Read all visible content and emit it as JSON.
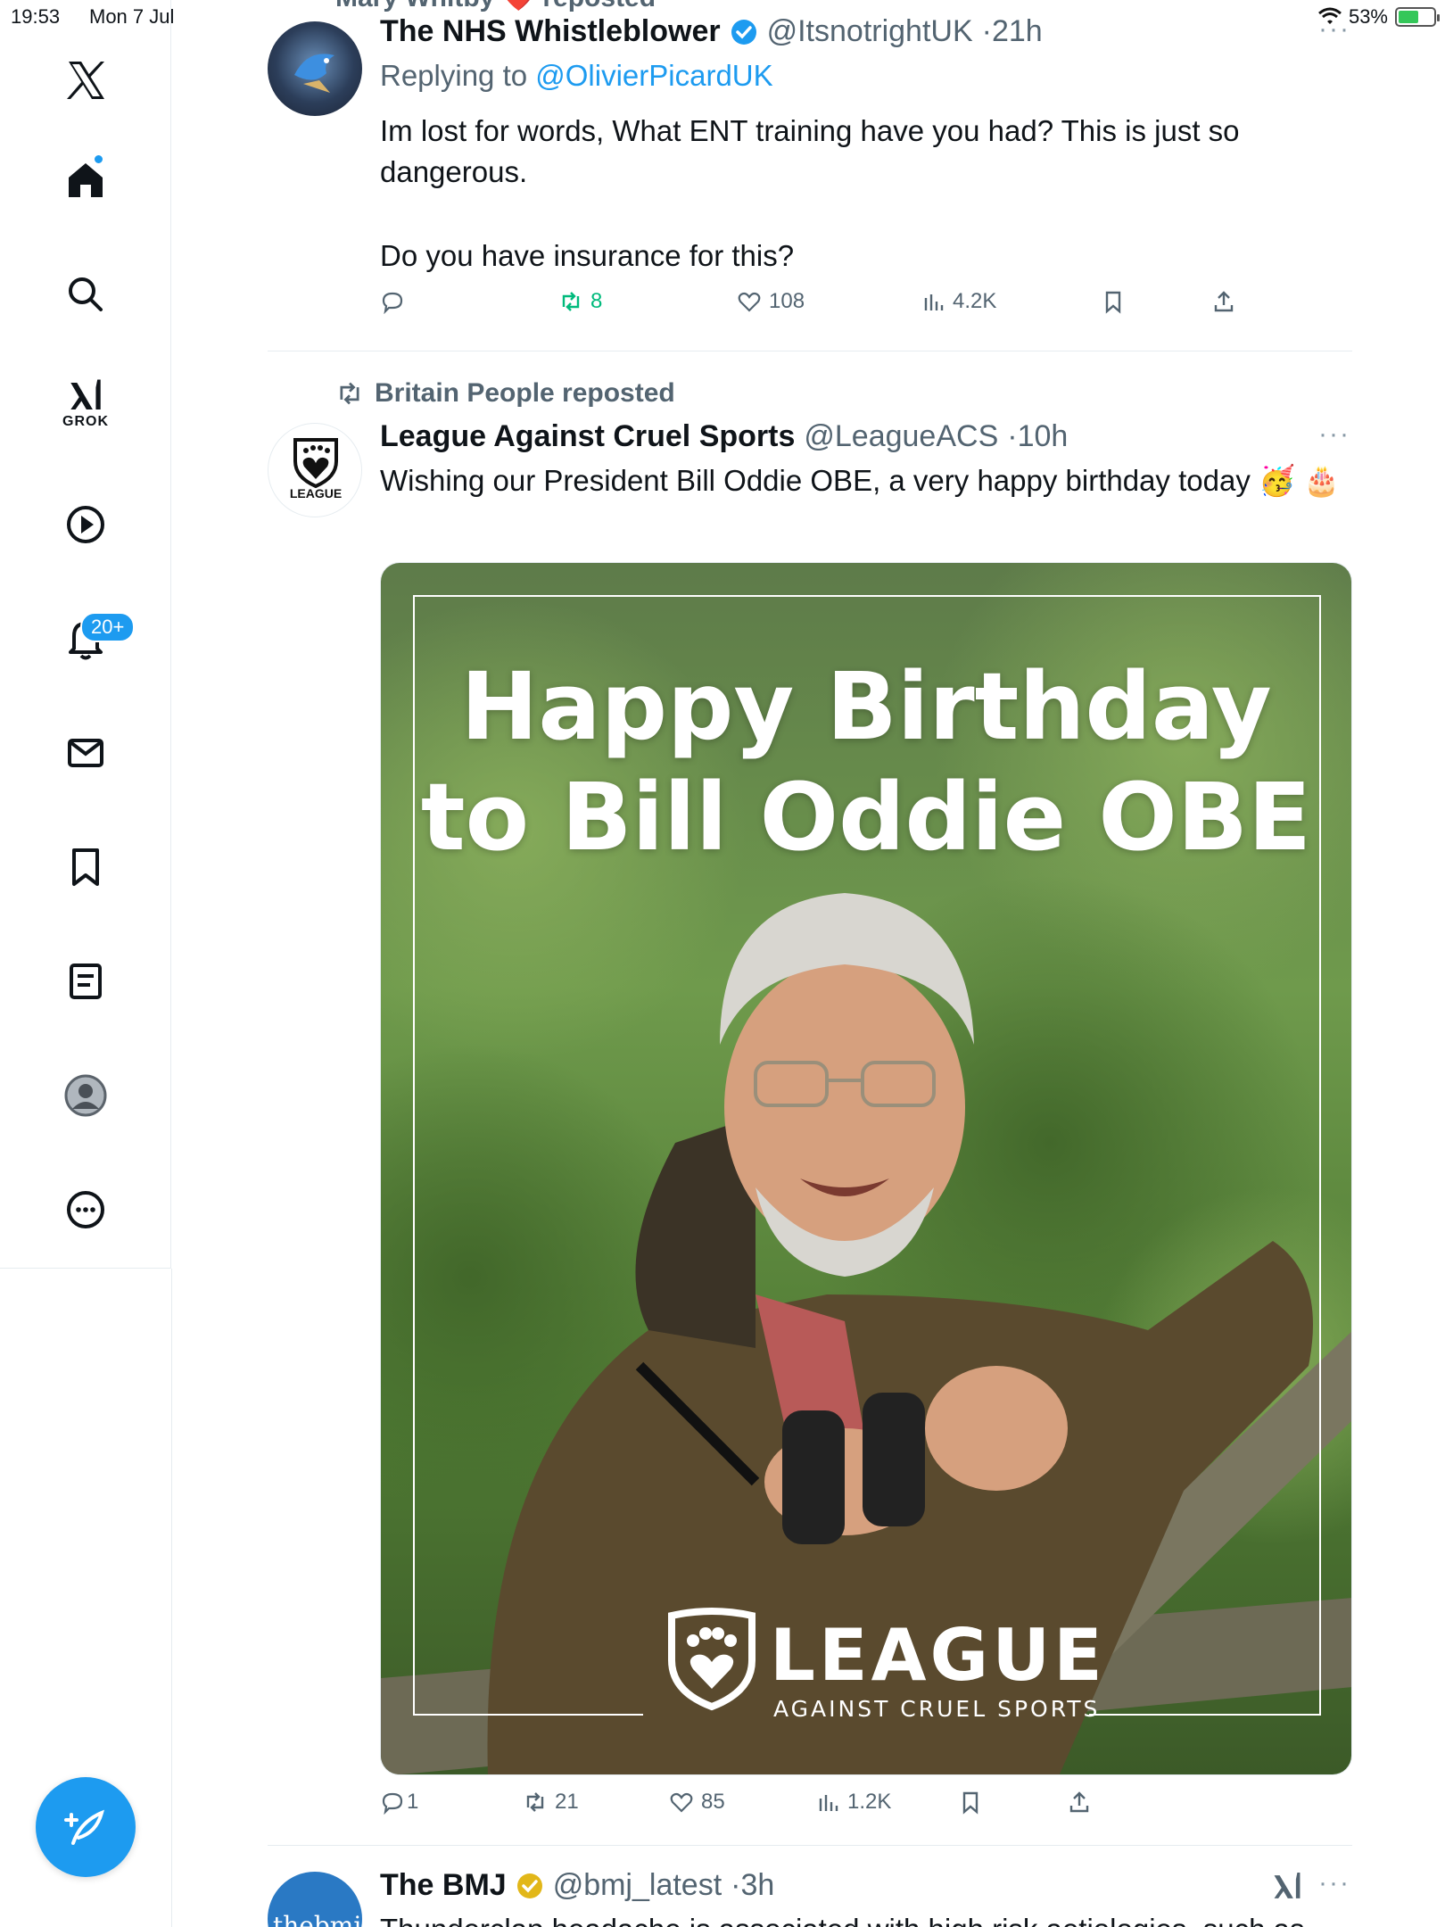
{
  "status_bar": {
    "time": "19:53",
    "date": "Mon 7 Jul",
    "battery": "53%"
  },
  "sidebar": {
    "grok_label": "GROK",
    "notifications_badge": "20+",
    "items": [
      "x-logo",
      "home",
      "search",
      "grok",
      "video",
      "notifications",
      "messages",
      "bookmarks",
      "lists",
      "profile",
      "more"
    ]
  },
  "tweet1": {
    "top_repost_partial": "Mary Whitby ❤️ reposted",
    "name": "The NHS Whistleblower",
    "handle": "@ItsnotrightUK",
    "time": "21h",
    "replying_prefix": "Replying to ",
    "replying_handle": "@OlivierPicardUK",
    "text_line1": "Im lost for words, What ENT training have you had?  This is just so dangerous.",
    "text_line2": "Do you have insurance for this?",
    "stats": {
      "reposts": "8",
      "likes": "108",
      "views": "4.2K"
    }
  },
  "tweet2": {
    "reposted_by": "Britain People reposted",
    "name": "League Against Cruel Sports",
    "handle": "@LeagueACS",
    "time": "10h",
    "text": "Wishing our President Bill Oddie OBE, a very happy birthday today 🥳 🎂",
    "avatar_label": "LEAGUE",
    "media": {
      "title_line1": "Happy Birthday",
      "title_line2": "to Bill Oddie OBE",
      "logo_word": "LEAGUE",
      "logo_sub": "AGAINST CRUEL SPORTS"
    },
    "stats": {
      "replies": "1",
      "reposts": "21",
      "likes": "85",
      "views": "1.2K"
    }
  },
  "tweet3": {
    "name": "The BMJ",
    "handle": "@bmj_latest",
    "time": "3h",
    "avatar_label": "thebmj",
    "text_partial": "Thunderclap headache is associated with high risk aetiologies, such as"
  },
  "colors": {
    "accent": "#1d9bf0",
    "repost_green": "#00ba7c",
    "muted": "#536471"
  }
}
